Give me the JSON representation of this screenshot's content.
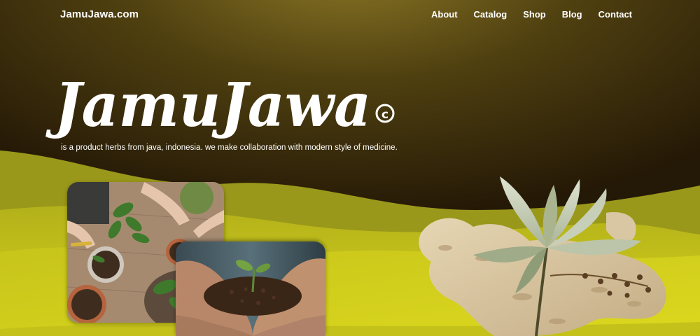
{
  "header": {
    "site_name": "JamuJawa.com",
    "nav": [
      {
        "label": "About"
      },
      {
        "label": "Catalog"
      },
      {
        "label": "Shop"
      },
      {
        "label": "Blog"
      },
      {
        "label": "Contact"
      }
    ]
  },
  "hero": {
    "logo_text": "JamuJawa",
    "logo_mark": "©",
    "tagline": "is a product herbs from java, indonesia. we make collaboration with modern style of medicine."
  },
  "colors": {
    "dark_brown": "#2a1d06",
    "olive": "#7a6a1e",
    "lime": "#cfcc1c",
    "white": "#ffffff"
  }
}
